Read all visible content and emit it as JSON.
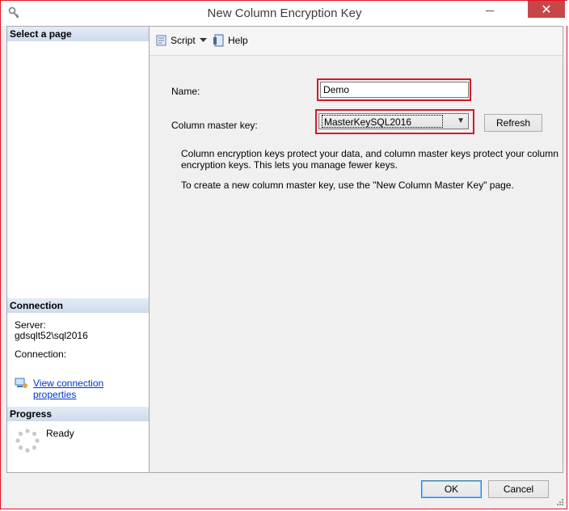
{
  "window": {
    "title": "New Column Encryption Key",
    "close_glyph": "✕"
  },
  "left_pane": {
    "select_page_header": "Select a page",
    "connection_header": "Connection",
    "server_label": "Server:",
    "server_value": "gdsqlt52\\sql2016",
    "connection_label": "Connection:",
    "view_connection_link": "View connection properties",
    "progress_header": "Progress",
    "progress_status": "Ready"
  },
  "toolbar": {
    "script_label": "Script",
    "help_label": "Help"
  },
  "form": {
    "name_label": "Name:",
    "name_value": "Demo",
    "cmk_label": "Column master key:",
    "cmk_value": "MasterKeySQL2016",
    "refresh_label": "Refresh",
    "info_line1": "Column encryption keys protect your data, and column master keys protect your column",
    "info_line2": "encryption keys. This lets you manage fewer keys.",
    "info_line3": "To create a new column master key, use the \"New Column Master Key\" page."
  },
  "footer": {
    "ok_label": "OK",
    "cancel_label": "Cancel"
  },
  "colors": {
    "highlight_red": "#d11b2a",
    "link_blue": "#0033cc",
    "close_red": "#c7464a"
  },
  "icons": [
    "key-app-icon",
    "script-icon",
    "help-icon",
    "connection-properties-icon",
    "progress-spinner-icon"
  ]
}
